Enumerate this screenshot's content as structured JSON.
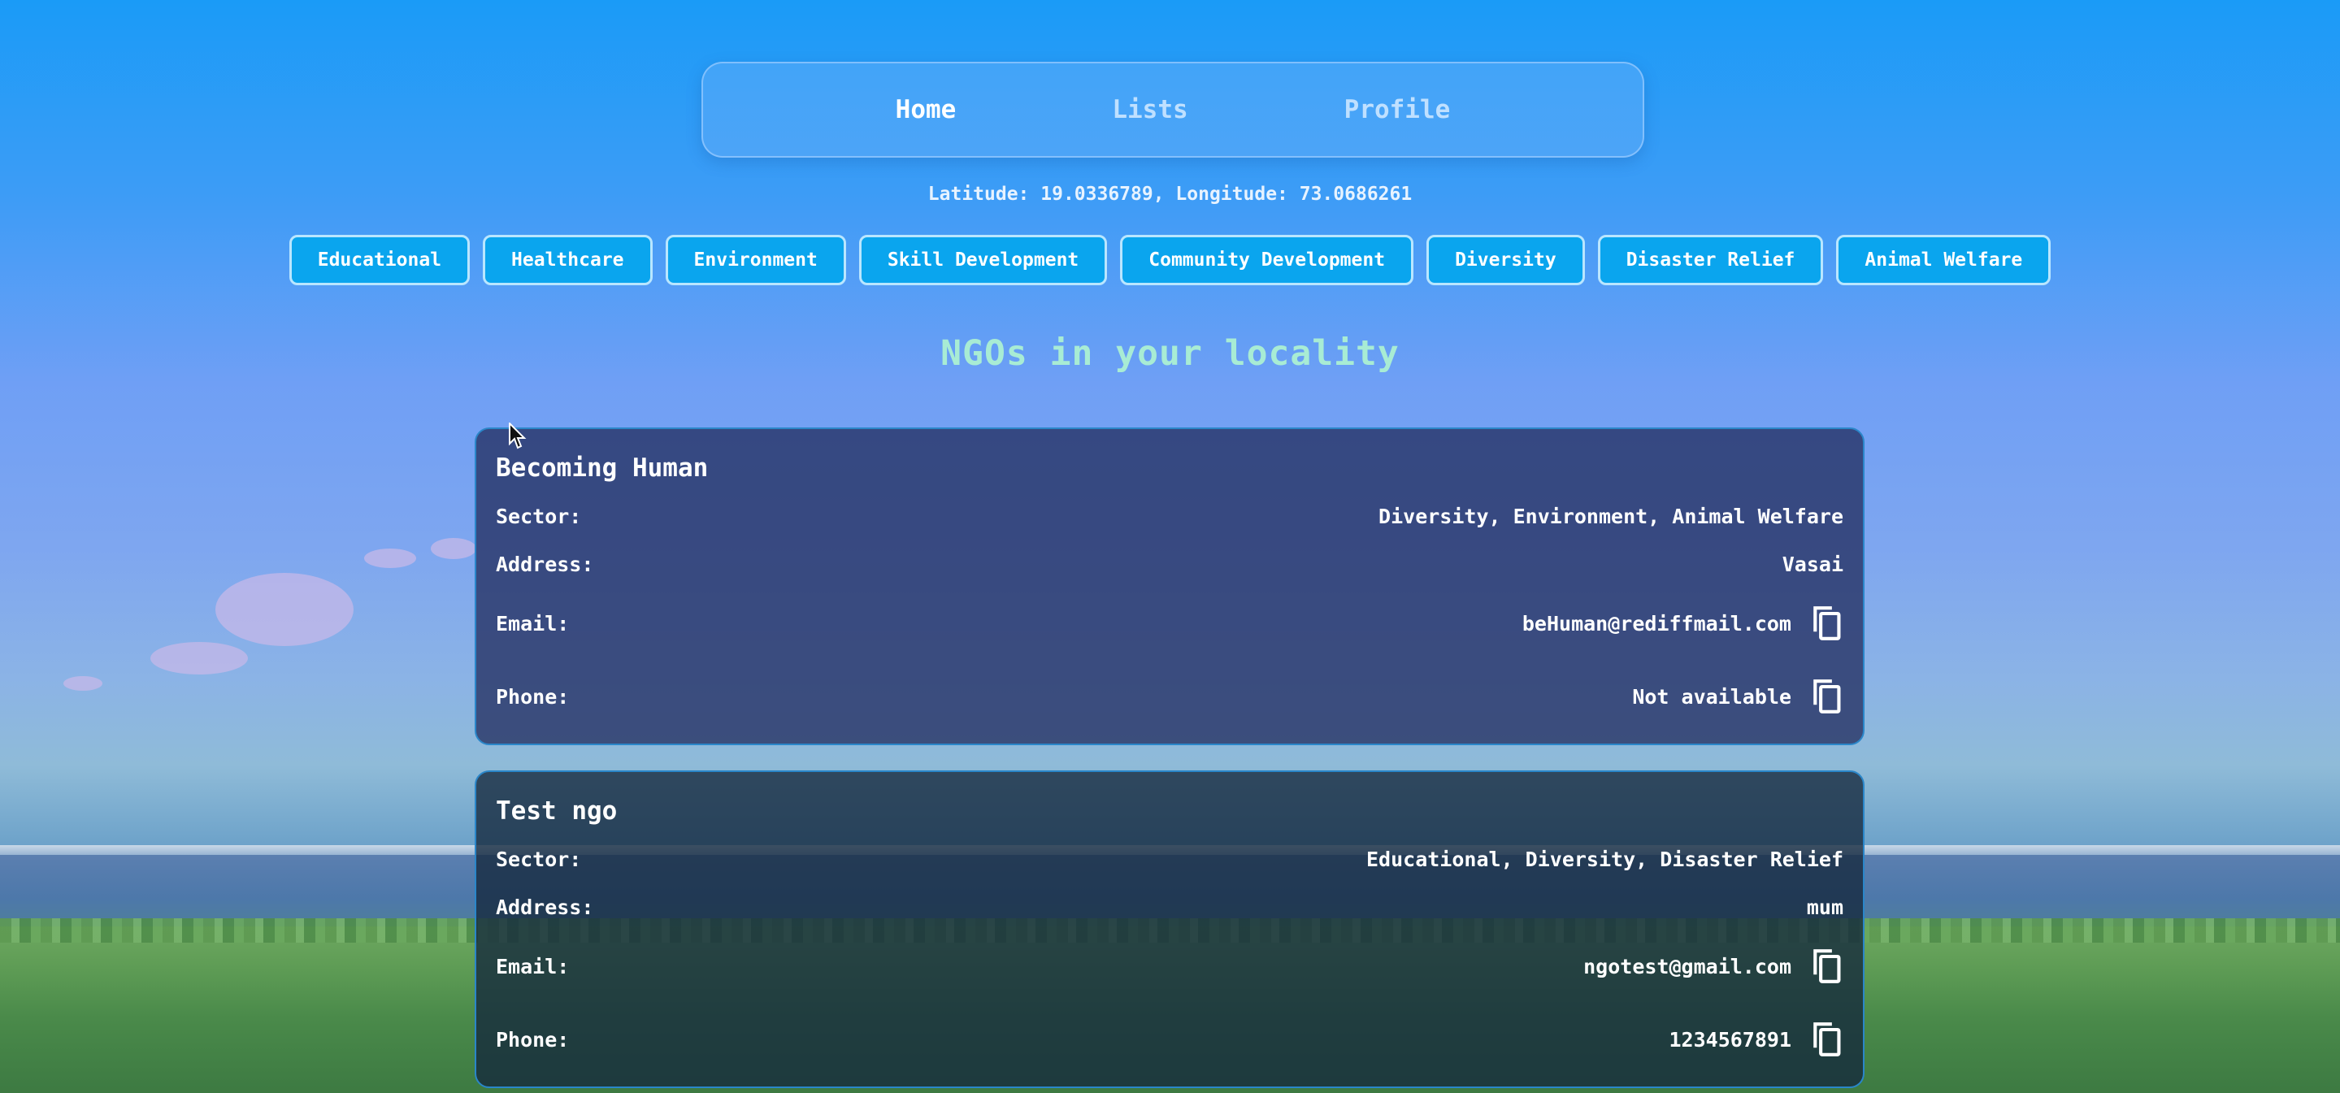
{
  "nav": {
    "items": [
      {
        "label": "Home",
        "active": true
      },
      {
        "label": "Lists",
        "active": false
      },
      {
        "label": "Profile",
        "active": false
      }
    ]
  },
  "location": {
    "text": "Latitude: 19.0336789, Longitude: 73.0686261"
  },
  "sectors": [
    "Educational",
    "Healthcare",
    "Environment",
    "Skill Development",
    "Community Development",
    "Diversity",
    "Disaster Relief",
    "Animal Welfare"
  ],
  "section_title": "NGOs in your locality",
  "ngos": [
    {
      "name": "Becoming Human",
      "sector_label": "Sector:",
      "sector": "Diversity, Environment, Animal Welfare",
      "address_label": "Address:",
      "address": "Vasai",
      "email_label": "Email:",
      "email": "beHuman@rediffmail.com",
      "phone_label": "Phone:",
      "phone": "Not available"
    },
    {
      "name": "Test ngo",
      "sector_label": "Sector:",
      "sector": "Educational, Diversity, Disaster Relief",
      "address_label": "Address:",
      "address": "mum",
      "email_label": "Email:",
      "email": "ngotest@gmail.com",
      "phone_label": "Phone:",
      "phone": "1234567891"
    }
  ],
  "icons": {
    "copy": "copy-icon",
    "cursor": "mouse-pointer-icon"
  },
  "colors": {
    "chip_bg": "#0aa5ee",
    "title": "#a8ecd4",
    "nav_active": "#ffffff",
    "nav_inactive": "#bfe0ff"
  }
}
